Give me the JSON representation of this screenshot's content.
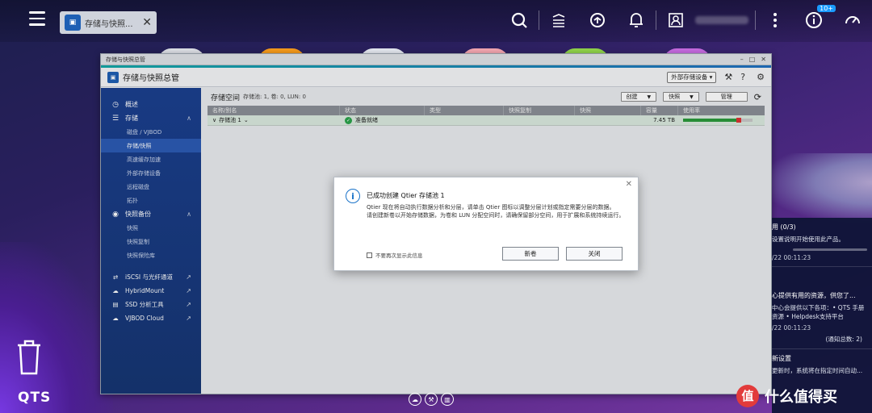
{
  "topbar": {
    "tab_label": "存储与快照...",
    "tab_icon_text": "▣",
    "tab_close": "✕",
    "notification_badge": "10+"
  },
  "window": {
    "title": "存储与快照总管",
    "app_name": "存储与快照总管",
    "ext_storage_button": "外部存储设备 ▾",
    "controls": [
      "–",
      "□",
      "✕"
    ]
  },
  "sidebar": {
    "sections": [
      {
        "label": "概述",
        "icon": "◷"
      },
      {
        "label": "存储",
        "icon": "☰",
        "chevron": "∧"
      }
    ],
    "storage_items": [
      "磁盘 / VJBOD",
      "存储/快照",
      "高速缓存加速",
      "外部存储设备",
      "远程磁盘",
      "拓扑"
    ],
    "backup_section": {
      "label": "快照备份",
      "icon": "◉",
      "chevron": "∧"
    },
    "backup_items": [
      "快照",
      "快照复制",
      "快照保险库"
    ],
    "external_links": [
      {
        "label": "iSCSI 与光纤通道",
        "icon": "⇄"
      },
      {
        "label": "HybridMount",
        "icon": "☁"
      },
      {
        "label": "SSD 分析工具",
        "icon": "▤"
      },
      {
        "label": "VJBOD Cloud",
        "icon": "☁"
      }
    ]
  },
  "content": {
    "title": "存储空间",
    "summary": "存储池: 1, 卷: 0, LUN: 0",
    "buttons": {
      "create": "创建",
      "snapshot": "快照",
      "manage": "管理"
    },
    "table": {
      "headers": [
        "名称/别名",
        "状态",
        "类型",
        "快照复制",
        "快照",
        "容量",
        "使用率"
      ],
      "rows": [
        {
          "name": "存储池 1",
          "status": "准备就绪",
          "type": "",
          "replica": "",
          "snapshot": "",
          "capacity": "7.45 TB",
          "usage_fraction": 0.8
        }
      ]
    }
  },
  "dialog": {
    "title": "已成功创建 Qtier 存储池 1",
    "paragraph1": "Qtier 现在将自动执行数据分析和分层，请单击 Qtier 图标以调整分层计划或指定需要分层的数据。",
    "paragraph2": "请创建新卷以开始存储数据，为卷和 LUN 分配空间时，请确保留部分空间，用于扩展和系统持续运行。",
    "checkbox_label": "不要再次显示此信息",
    "btn_new_volume": "新卷",
    "btn_close": "关闭"
  },
  "desktop": {
    "logo": "QTS"
  },
  "notifications": {
    "cards": [
      {
        "title": "用 (0/3)",
        "text": "设置说明开始使用此产品。",
        "time": "/22 00:11:23"
      },
      {
        "title": "心提供有用的资源，供您了...",
        "text": "中心会提供以下各项：• QTS 手册资源 • Helpdesk支持平台",
        "time": "/22 00:11:23"
      },
      {
        "title": "新设置",
        "text": "更新时，系统将在指定时间自动...",
        "time": ""
      }
    ],
    "total": "(通知总数: 2)",
    "watermark": "什么值得买"
  }
}
